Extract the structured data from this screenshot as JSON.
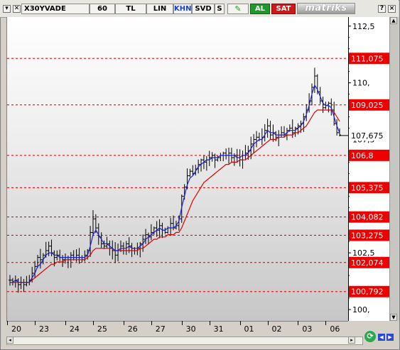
{
  "toolbar": {
    "symbol": "X30YVADE",
    "period": "60",
    "currency": "TL",
    "scale": "LIN",
    "khn": "KHN",
    "svd": "SVD",
    "s_btn": "S",
    "buy": "AL",
    "sell": "SAT",
    "brand": "matriks",
    "help": "?",
    "close": "×"
  },
  "colors": {
    "ma_fast": "#1f1fd6",
    "ma_slow": "#e00000",
    "level_line": "#c00000",
    "buy": "#1f9a2a",
    "sell": "#d01818"
  },
  "chart_data": {
    "type": "ohlc",
    "symbol": "X30YVADE",
    "interval": "60",
    "ylim": [
      99.5,
      112.9
    ],
    "y_ticks": [
      {
        "value": 112.5,
        "label": "112,5"
      },
      {
        "value": 110.0,
        "label": "110,"
      },
      {
        "value": 107.5,
        "label": "107,5"
      },
      {
        "value": 102.5,
        "label": "102,5"
      },
      {
        "value": 100.0,
        "label": "100,"
      }
    ],
    "levels": [
      {
        "value": 111.075,
        "label": "111,075"
      },
      {
        "value": 109.025,
        "label": "109,025"
      },
      {
        "value": 106.8,
        "label": "106,8"
      },
      {
        "value": 105.375,
        "label": "105,375"
      },
      {
        "value": 104.082,
        "label": "104,082"
      },
      {
        "value": 103.275,
        "label": "103,275"
      },
      {
        "value": 102.074,
        "label": "102,074"
      },
      {
        "value": 100.792,
        "label": "100,792"
      }
    ],
    "last_price": {
      "value": 107.675,
      "label": "107,675"
    },
    "x_labels": [
      "20",
      "23",
      "24",
      "25",
      "26",
      "27",
      "30",
      "31",
      "01",
      "02",
      "03",
      "06"
    ],
    "close": [
      101.3,
      101.2,
      101.3,
      101.1,
      101.2,
      101.1,
      101.2,
      101.3,
      101.6,
      101.9,
      102.3,
      102.2,
      102.4,
      102.6,
      102.8,
      102.5,
      102.3,
      102.4,
      102.3,
      102.2,
      102.3,
      102.2,
      102.4,
      102.3,
      102.4,
      102.3,
      102.2,
      102.4,
      102.6,
      103.4,
      104.0,
      103.6,
      103.2,
      102.9,
      102.8,
      102.9,
      102.7,
      102.6,
      102.4,
      102.6,
      102.8,
      102.6,
      102.9,
      102.8,
      102.7,
      102.6,
      102.7,
      102.9,
      103.1,
      103.3,
      103.2,
      103.4,
      103.6,
      103.5,
      103.7,
      103.5,
      103.4,
      103.6,
      103.8,
      103.6,
      103.7,
      104.0,
      105.0,
      105.4,
      105.9,
      106.1,
      106.0,
      106.2,
      106.4,
      106.6,
      106.5,
      106.6,
      106.7,
      106.8,
      106.6,
      106.7,
      106.8,
      106.9,
      106.8,
      106.9,
      106.7,
      106.8,
      106.7,
      106.6,
      106.8,
      106.9,
      107.0,
      107.3,
      107.5,
      107.6,
      107.5,
      107.6,
      107.9,
      108.1,
      107.7,
      107.8,
      107.6,
      107.7,
      107.8,
      107.7,
      107.9,
      108.0,
      107.8,
      108.0,
      108.1,
      108.2,
      108.5,
      108.8,
      109.2,
      109.8,
      110.3,
      109.6,
      109.2,
      108.9,
      109.0,
      109.1,
      108.8,
      108.2,
      107.8,
      107.7
    ],
    "ma_fast": [
      101.2,
      101.2,
      101.3,
      101.2,
      101.2,
      101.2,
      101.2,
      101.2,
      101.4,
      101.6,
      101.9,
      102.0,
      102.2,
      102.4,
      102.5,
      102.5,
      102.4,
      102.4,
      102.3,
      102.3,
      102.3,
      102.3,
      102.3,
      102.3,
      102.3,
      102.3,
      102.3,
      102.3,
      102.4,
      102.8,
      103.3,
      103.5,
      103.3,
      103.1,
      102.9,
      102.9,
      102.8,
      102.7,
      102.6,
      102.6,
      102.7,
      102.7,
      102.7,
      102.8,
      102.7,
      102.7,
      102.7,
      102.8,
      102.9,
      103.1,
      103.2,
      103.3,
      103.4,
      103.5,
      103.6,
      103.5,
      103.5,
      103.6,
      103.6,
      103.6,
      103.7,
      103.9,
      104.5,
      105.0,
      105.5,
      105.8,
      105.9,
      106.1,
      106.3,
      106.4,
      106.5,
      106.6,
      106.6,
      106.7,
      106.7,
      106.7,
      106.8,
      106.8,
      106.8,
      106.8,
      106.8,
      106.8,
      106.7,
      106.7,
      106.8,
      106.8,
      106.9,
      107.1,
      107.3,
      107.4,
      107.5,
      107.5,
      107.7,
      107.9,
      107.8,
      107.8,
      107.7,
      107.7,
      107.7,
      107.7,
      107.8,
      107.9,
      107.9,
      107.9,
      108.0,
      108.1,
      108.3,
      108.6,
      109.0,
      109.5,
      109.9,
      109.7,
      109.4,
      109.1,
      109.0,
      109.0,
      108.9,
      108.5,
      108.1,
      107.8
    ],
    "ma_slow": [
      101.2,
      101.2,
      101.2,
      101.2,
      101.2,
      101.2,
      101.2,
      101.2,
      101.3,
      101.4,
      101.5,
      101.6,
      101.7,
      101.8,
      101.9,
      102.0,
      102.0,
      102.1,
      102.1,
      102.1,
      102.2,
      102.2,
      102.2,
      102.2,
      102.2,
      102.2,
      102.2,
      102.2,
      102.3,
      102.4,
      102.6,
      102.7,
      102.7,
      102.7,
      102.7,
      102.7,
      102.7,
      102.7,
      102.6,
      102.6,
      102.6,
      102.6,
      102.6,
      102.6,
      102.6,
      102.6,
      102.6,
      102.7,
      102.7,
      102.8,
      102.9,
      103.0,
      103.1,
      103.1,
      103.2,
      103.2,
      103.2,
      103.3,
      103.3,
      103.3,
      103.4,
      103.4,
      103.6,
      103.9,
      104.2,
      104.5,
      104.8,
      105.0,
      105.2,
      105.4,
      105.6,
      105.7,
      105.8,
      105.9,
      106.0,
      106.1,
      106.2,
      106.3,
      106.4,
      106.4,
      106.5,
      106.5,
      106.5,
      106.6,
      106.6,
      106.6,
      106.7,
      106.8,
      106.9,
      107.0,
      107.1,
      107.2,
      107.3,
      107.4,
      107.5,
      107.5,
      107.5,
      107.6,
      107.6,
      107.6,
      107.7,
      107.7,
      107.7,
      107.8,
      107.8,
      107.9,
      108.0,
      108.1,
      108.3,
      108.5,
      108.7,
      108.8,
      108.8,
      108.8,
      108.8,
      108.8,
      108.8,
      108.7,
      108.5,
      108.3
    ]
  }
}
